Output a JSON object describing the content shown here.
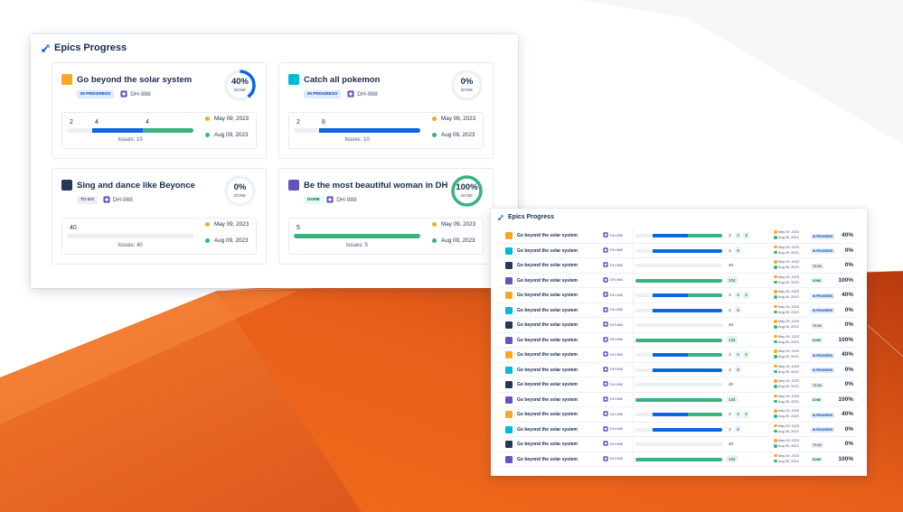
{
  "colors": {
    "orange": "#f9a825",
    "teal": "#00b8d9",
    "navy": "#253858",
    "purple": "#6554c0",
    "blue": "#0c66e4",
    "green": "#36b37e",
    "track": "#edeff3"
  },
  "cards_panel": {
    "title": "Epics Progress",
    "icon": "jira-logo-icon",
    "cards": [
      {
        "title": "Go beyond the solar system",
        "color": "orange",
        "status": "IN PROGRESS",
        "status_kind": "inprogress",
        "key": "DH-988",
        "percent": "40%",
        "percent_value": 40,
        "done_label": "DONE",
        "segments": [
          {
            "label": "2",
            "value": 2,
            "color": "track"
          },
          {
            "label": "4",
            "value": 4,
            "color": "blue"
          },
          {
            "label": "4",
            "value": 4,
            "color": "green"
          }
        ],
        "total": 10,
        "issues": "Issues: 10",
        "start_date": "May 09, 2023",
        "end_date": "Aug 09, 2023"
      },
      {
        "title": "Catch all pokemon",
        "color": "teal",
        "status": "IN PROGRESS",
        "status_kind": "inprogress",
        "key": "DH-988",
        "percent": "0%",
        "percent_value": 0,
        "done_label": "DONE",
        "segments": [
          {
            "label": "2",
            "value": 2,
            "color": "track"
          },
          {
            "label": "8",
            "value": 8,
            "color": "blue"
          }
        ],
        "total": 10,
        "issues": "Issues: 10",
        "start_date": "May 09, 2023",
        "end_date": "Aug 09, 2023"
      },
      {
        "title": "Sing and dance like Beyonce",
        "color": "navy",
        "status": "TO DO",
        "status_kind": "todo",
        "key": "DH-988",
        "percent": "0%",
        "percent_value": 0,
        "done_label": "DONE",
        "segments": [
          {
            "label": "40",
            "value": 40,
            "color": "track"
          }
        ],
        "total": 40,
        "issues": "Issues: 40",
        "start_date": "May 09, 2023",
        "end_date": "Aug 09, 2023"
      },
      {
        "title": "Be the most beautiful woman in DH",
        "color": "purple",
        "status": "DONE",
        "status_kind": "done",
        "key": "DH-988",
        "percent": "100%",
        "percent_value": 100,
        "done_label": "DONE",
        "segments": [
          {
            "label": "5",
            "value": 5,
            "color": "green"
          }
        ],
        "total": 5,
        "issues": "Issues: 5",
        "start_date": "May 09, 2023",
        "end_date": "Aug 09, 2023"
      }
    ]
  },
  "table_panel": {
    "title": "Epics Progress",
    "icon": "jira-logo-icon",
    "row_types": {
      "a": {
        "color": "orange",
        "status": "IN PROGRESS",
        "status_kind": "inprogress",
        "percent": "40%",
        "segments": [
          {
            "value": 2,
            "color": "track"
          },
          {
            "value": 4,
            "color": "blue"
          },
          {
            "value": 4,
            "color": "green"
          }
        ],
        "chips": [
          {
            "label": "2",
            "kind": "plain"
          },
          {
            "label": "4",
            "kind": "inprogress"
          },
          {
            "label": "4",
            "kind": "done"
          }
        ]
      },
      "b": {
        "color": "teal",
        "status": "IN PROGRESS",
        "status_kind": "inprogress",
        "percent": "0%",
        "segments": [
          {
            "value": 2,
            "color": "track"
          },
          {
            "value": 8,
            "color": "blue"
          }
        ],
        "chips": [
          {
            "label": "2",
            "kind": "plain"
          },
          {
            "label": "8",
            "kind": "inprogress"
          }
        ]
      },
      "c": {
        "color": "navy",
        "status": "TO DO",
        "status_kind": "todo",
        "percent": "0%",
        "segments": [
          {
            "value": 40,
            "color": "track"
          }
        ],
        "chips": [
          {
            "label": "40",
            "kind": "plain"
          }
        ]
      },
      "d": {
        "color": "purple",
        "status": "DONE",
        "status_kind": "done",
        "percent": "100%",
        "segments": [
          {
            "value": 134,
            "color": "green"
          }
        ],
        "chips": [
          {
            "label": "134",
            "kind": "done"
          }
        ]
      }
    },
    "rows": [
      {
        "name": "Go beyond the solar system",
        "key": "DH-988",
        "type": "a",
        "start_date": "May 09, 2023",
        "end_date": "Aug 09, 2023"
      },
      {
        "name": "Go beyond the solar system",
        "key": "DH-988",
        "type": "b",
        "start_date": "May 09, 2023",
        "end_date": "Aug 09, 2023"
      },
      {
        "name": "Go beyond the solar system",
        "key": "DH-988",
        "type": "c",
        "start_date": "May 09, 2023",
        "end_date": "Aug 09, 2023"
      },
      {
        "name": "Go beyond the solar system",
        "key": "DH-988",
        "type": "d",
        "start_date": "May 09, 2023",
        "end_date": "Aug 09, 2023"
      },
      {
        "name": "Go beyond the solar system",
        "key": "DH-988",
        "type": "a",
        "start_date": "May 09, 2023",
        "end_date": "Aug 09, 2023"
      },
      {
        "name": "Go beyond the solar system",
        "key": "DH-988",
        "type": "b",
        "start_date": "May 09, 2023",
        "end_date": "Aug 09, 2023"
      },
      {
        "name": "Go beyond the solar system",
        "key": "DH-988",
        "type": "c",
        "start_date": "May 09, 2023",
        "end_date": "Aug 09, 2023"
      },
      {
        "name": "Go beyond the solar system",
        "key": "DH-988",
        "type": "d",
        "start_date": "May 09, 2023",
        "end_date": "Aug 09, 2023"
      },
      {
        "name": "Go beyond the solar system",
        "key": "DH-988",
        "type": "a",
        "start_date": "May 09, 2023",
        "end_date": "Aug 09, 2023"
      },
      {
        "name": "Go beyond the solar system",
        "key": "DH-988",
        "type": "b",
        "start_date": "May 09, 2023",
        "end_date": "Aug 09, 2023"
      },
      {
        "name": "Go beyond the solar system",
        "key": "DH-988",
        "type": "c",
        "start_date": "May 09, 2023",
        "end_date": "Aug 09, 2023"
      },
      {
        "name": "Go beyond the solar system",
        "key": "DH-988",
        "type": "d",
        "start_date": "May 09, 2023",
        "end_date": "Aug 09, 2023"
      },
      {
        "name": "Go beyond the solar system",
        "key": "DH-988",
        "type": "a",
        "start_date": "May 09, 2023",
        "end_date": "Aug 09, 2023"
      },
      {
        "name": "Go beyond the solar system",
        "key": "DH-988",
        "type": "b",
        "start_date": "May 09, 2023",
        "end_date": "Aug 09, 2023"
      },
      {
        "name": "Go beyond the solar system",
        "key": "DH-988",
        "type": "c",
        "start_date": "May 09, 2023",
        "end_date": "Aug 09, 2023"
      },
      {
        "name": "Go beyond the solar system",
        "key": "DH-988",
        "type": "d",
        "start_date": "May 09, 2023",
        "end_date": "Aug 09, 2023"
      }
    ]
  }
}
